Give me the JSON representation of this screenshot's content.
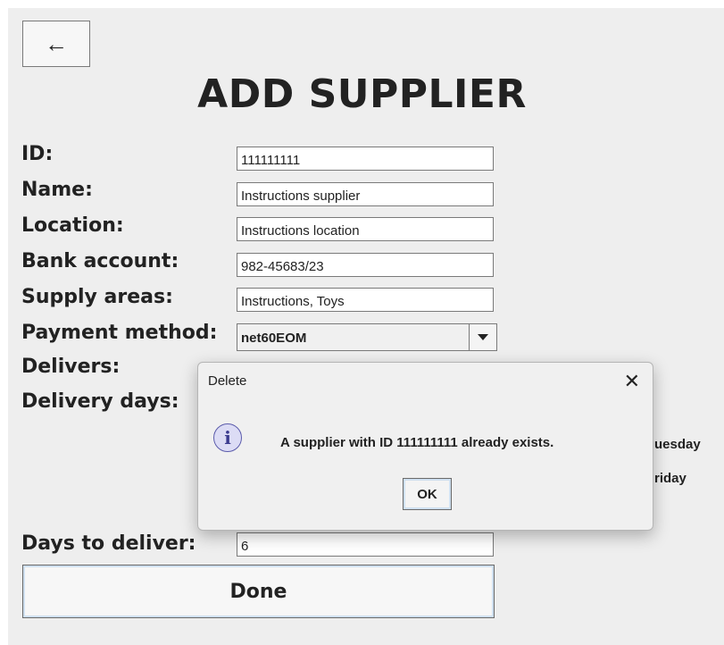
{
  "page": {
    "back_icon": "←",
    "title": "ADD SUPPLIER"
  },
  "form": {
    "id_label": "ID:",
    "id_value": "111111111",
    "name_label": "Name:",
    "name_value": "Instructions supplier",
    "location_label": "Location:",
    "location_value": "Instructions location",
    "bank_label": "Bank account:",
    "bank_value": "982-45683/23",
    "areas_label": "Supply areas:",
    "areas_value": "Instructions, Toys",
    "payment_label": "Payment method:",
    "payment_value": "net60EOM",
    "delivers_label": "Delivers:",
    "delivery_days_label": "Delivery days:",
    "day_partial_1": "uesday",
    "day_partial_2": "riday",
    "days_to_deliver_label": "Days to deliver:",
    "days_to_deliver_value": "6",
    "done_label": "Done"
  },
  "dialog": {
    "title": "Delete",
    "close_icon": "✕",
    "info_glyph": "i",
    "message": "A supplier with ID 111111111 already exists.",
    "ok_label": "OK"
  }
}
